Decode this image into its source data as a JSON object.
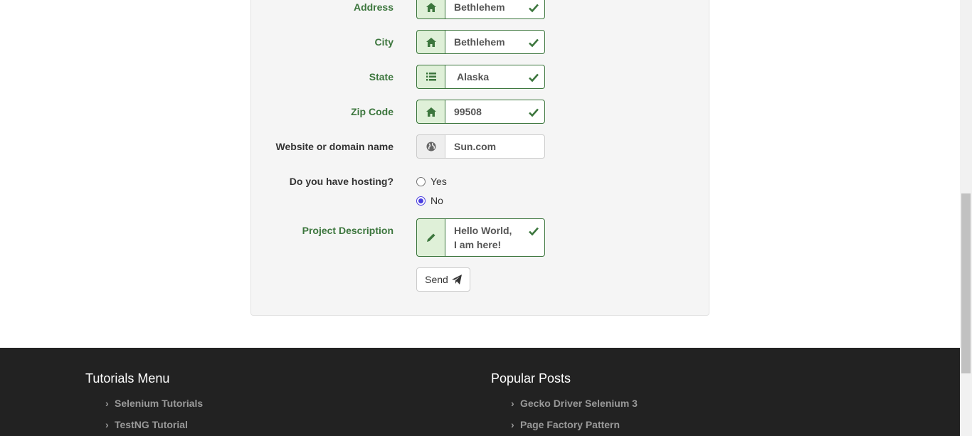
{
  "form": {
    "address": {
      "label": "Address",
      "value": "Bethlehem",
      "icon": "home-icon"
    },
    "city": {
      "label": "City",
      "value": "Bethlehem",
      "icon": "home-icon"
    },
    "state": {
      "label": "State",
      "value": "Alaska",
      "icon": "list-icon"
    },
    "zip": {
      "label": "Zip Code",
      "value": "99508",
      "icon": "home-icon"
    },
    "website": {
      "label": "Website or domain name",
      "value": "Sun.com",
      "icon": "globe-icon"
    },
    "hosting": {
      "label": "Do you have hosting?",
      "options": [
        {
          "label": "Yes",
          "checked": false
        },
        {
          "label": "No",
          "checked": true
        }
      ]
    },
    "description": {
      "label": "Project Description",
      "line1": "Hello World,",
      "line2": "I am here!",
      "icon": "pencil-icon"
    },
    "send_label": "Send"
  },
  "footer": {
    "tutorials": {
      "title": "Tutorials Menu",
      "links": [
        "Selenium Tutorials",
        "TestNG Tutorial"
      ]
    },
    "popular": {
      "title": "Popular Posts",
      "links": [
        "Gecko Driver Selenium 3",
        "Page Factory Pattern"
      ]
    }
  },
  "colors": {
    "success": "#3c763d",
    "success_bg": "#dff0d8",
    "footer_bg": "#222222",
    "radio_accent": "#4a3ee0"
  }
}
